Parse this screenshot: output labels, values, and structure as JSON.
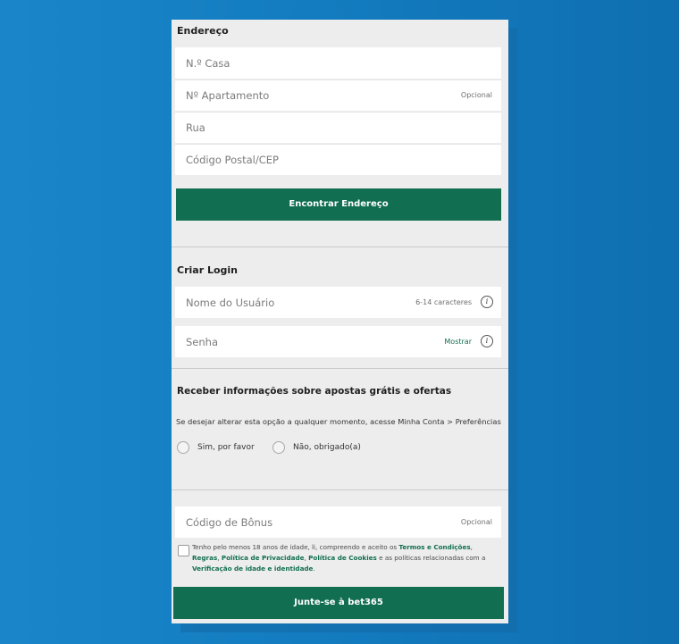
{
  "address": {
    "title": "Endereço",
    "house_number_placeholder": "N.º Casa",
    "apartment_placeholder": "Nº Apartamento",
    "apartment_hint": "Opcional",
    "street_placeholder": "Rua",
    "postal_placeholder": "Código Postal/CEP",
    "find_button": "Encontrar Endereço"
  },
  "login": {
    "title": "Criar Login",
    "username_placeholder": "Nome do Usuário",
    "username_hint": "6-14 caracteres",
    "password_placeholder": "Senha",
    "password_show": "Mostrar"
  },
  "offers": {
    "title": "Receber informações sobre apostas grátis e ofertas",
    "subtitle": "Se desejar alterar esta opção a qualquer momento, acesse Minha Conta > Preferências",
    "option_yes": "Sim, por favor",
    "option_no": "Não, obrigado(a)"
  },
  "bonus": {
    "placeholder": "Código de Bônus",
    "hint": "Opcional"
  },
  "terms": {
    "part1": "Tenho pelo menos 18 anos de idade, li, compreendo e aceito os ",
    "link_terms": "Termos e Condições",
    "sep1": ", ",
    "link_rules": "Regras",
    "sep2": ", ",
    "link_privacy": "Política de Privacidade",
    "sep3": ", ",
    "link_cookies": "Política de Cookies",
    "part2": " e as políticas relacionadas com a ",
    "link_verification": "Verificação de idade e identidade",
    "end": "."
  },
  "join_button": "Junte-se à bet365",
  "colors": {
    "accent": "#126e51",
    "background": "#137cc0",
    "panel": "#ecedec"
  }
}
